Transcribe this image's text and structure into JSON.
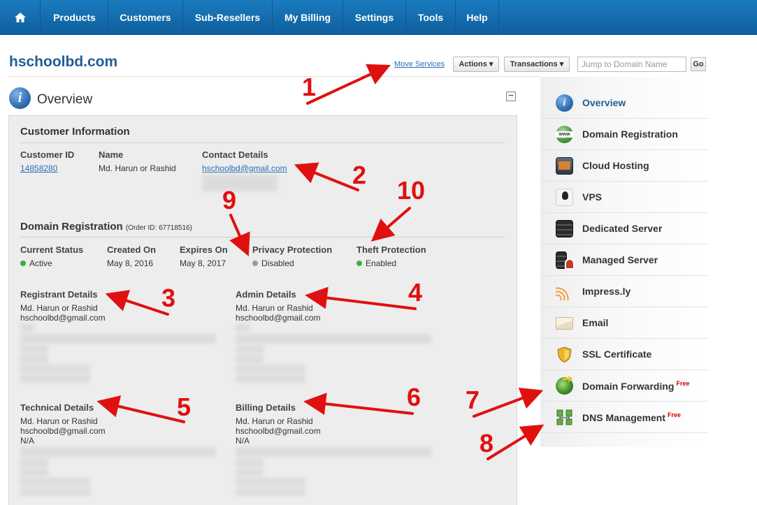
{
  "nav": {
    "items": [
      "Products",
      "Customers",
      "Sub-Resellers",
      "My Billing",
      "Settings",
      "Tools",
      "Help"
    ]
  },
  "header": {
    "domain": "hschoolbd.com",
    "move_services": "Move Services",
    "actions": "Actions ▾",
    "transactions": "Transactions ▾",
    "jump_placeholder": "Jump to Domain Name",
    "go": "Go"
  },
  "overview": {
    "title": "Overview",
    "collapse": "−"
  },
  "customer": {
    "title": "Customer Information",
    "id_label": "Customer ID",
    "id_value": "14858280",
    "name_label": "Name",
    "name_value": "Md. Harun or Rashid",
    "contact_label": "Contact Details",
    "contact_email": "hschoolbd@gmail.com"
  },
  "domain_reg": {
    "title": "Domain Registration",
    "order": "(Order ID: 67718516)",
    "status_label": "Current Status",
    "status_value": "Active",
    "created_label": "Created On",
    "created_value": "May 8, 2016",
    "expires_label": "Expires On",
    "expires_value": "May 8, 2017",
    "privacy_label": "Privacy Protection",
    "privacy_value": "Disabled",
    "theft_label": "Theft Protection",
    "theft_value": "Enabled"
  },
  "contacts": {
    "registrant": {
      "label": "Registrant Details",
      "name": "Md. Harun or Rashid",
      "email": "hschoolbd@gmail.com"
    },
    "admin": {
      "label": "Admin Details",
      "name": "Md. Harun or Rashid",
      "email": "hschoolbd@gmail.com"
    },
    "technical": {
      "label": "Technical Details",
      "name": "Md. Harun or Rashid",
      "email": "hschoolbd@gmail.com",
      "extra": "N/A"
    },
    "billing": {
      "label": "Billing Details",
      "name": "Md. Harun or Rashid",
      "email": "hschoolbd@gmail.com",
      "extra": "N/A"
    }
  },
  "sidebar": {
    "items": [
      {
        "label": "Overview",
        "icon": "info-icon"
      },
      {
        "label": "Domain Registration",
        "icon": "globe-www-icon"
      },
      {
        "label": "Cloud Hosting",
        "icon": "cloud-hosting-icon"
      },
      {
        "label": "VPS",
        "icon": "linux-penguin-icon"
      },
      {
        "label": "Dedicated Server",
        "icon": "server-icon"
      },
      {
        "label": "Managed Server",
        "icon": "managed-server-icon"
      },
      {
        "label": "Impress.ly",
        "icon": "impressly-icon"
      },
      {
        "label": "Email",
        "icon": "envelope-icon"
      },
      {
        "label": "SSL Certificate",
        "icon": "shield-icon"
      },
      {
        "label": "Domain Forwarding",
        "icon": "globe-arrow-icon",
        "badge": "Free"
      },
      {
        "label": "DNS Management",
        "icon": "dns-network-icon",
        "badge": "Free"
      }
    ]
  },
  "annotations": [
    "1",
    "2",
    "3",
    "4",
    "5",
    "6",
    "7",
    "8",
    "9",
    "10"
  ],
  "colors": {
    "nav": "#1a7bbf",
    "title": "#1f5e96",
    "link": "#2a6ebb",
    "annotation": "#e01010",
    "active": "#36b33c"
  }
}
